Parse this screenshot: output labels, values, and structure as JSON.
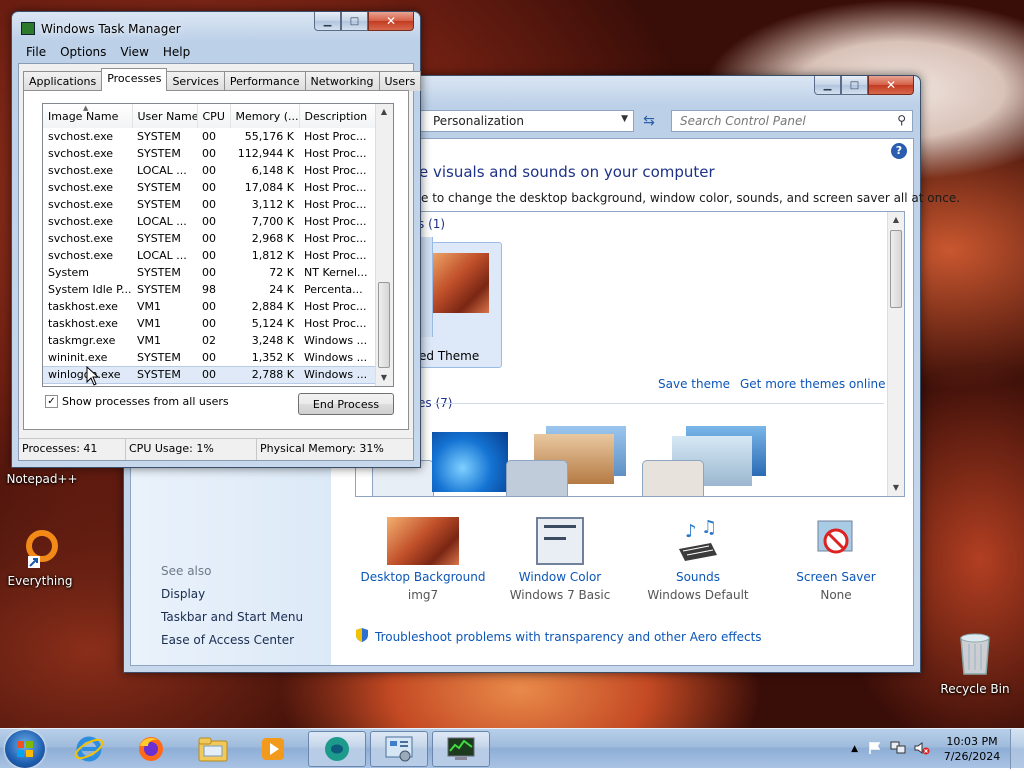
{
  "colors": {
    "accent": "#0c56b8",
    "heading": "#1e3287"
  },
  "desktop": {
    "icons": [
      {
        "label": "Notepad++",
        "icon": "notepadpp-icon"
      },
      {
        "label": "Everything",
        "icon": "everything-icon"
      },
      {
        "label": "Recycle Bin",
        "icon": "recycle-bin-icon"
      }
    ]
  },
  "control_panel": {
    "address": "Personalization",
    "search_placeholder": "Search Control Panel",
    "heading": "e visuals and sounds on your computer",
    "subheading": "e to change the desktop background, window color, sounds, and screen saver all at once.",
    "my_themes_label": "s (1)",
    "unsaved_theme_label": "ed Theme",
    "save_theme": "Save theme",
    "get_more_themes": "Get more themes online",
    "aero_themes_label": "es (7)",
    "bottom": [
      {
        "name": "Desktop Background",
        "value": "img7",
        "icon": "desktop-background-icon"
      },
      {
        "name": "Window Color",
        "value": "Windows 7 Basic",
        "icon": "window-color-icon"
      },
      {
        "name": "Sounds",
        "value": "Windows Default",
        "icon": "sounds-icon"
      },
      {
        "name": "Screen Saver",
        "value": "None",
        "icon": "screen-saver-icon"
      }
    ],
    "troubleshoot": "Troubleshoot problems with transparency and other Aero effects",
    "see_also": {
      "title": "See also",
      "links": [
        "Display",
        "Taskbar and Start Menu",
        "Ease of Access Center"
      ]
    }
  },
  "task_manager": {
    "title": "Windows Task Manager",
    "menu": [
      "File",
      "Options",
      "View",
      "Help"
    ],
    "tabs": [
      "Applications",
      "Processes",
      "Services",
      "Performance",
      "Networking",
      "Users"
    ],
    "active_tab": "Processes",
    "columns": [
      "Image Name",
      "User Name",
      "CPU",
      "Memory (...",
      "Description"
    ],
    "rows": [
      [
        "svchost.exe",
        "SYSTEM",
        "00",
        "55,176 K",
        "Host Proc..."
      ],
      [
        "svchost.exe",
        "SYSTEM",
        "00",
        "112,944 K",
        "Host Proc..."
      ],
      [
        "svchost.exe",
        "LOCAL ...",
        "00",
        "6,148 K",
        "Host Proc..."
      ],
      [
        "svchost.exe",
        "SYSTEM",
        "00",
        "17,084 K",
        "Host Proc..."
      ],
      [
        "svchost.exe",
        "SYSTEM",
        "00",
        "3,112 K",
        "Host Proc..."
      ],
      [
        "svchost.exe",
        "LOCAL ...",
        "00",
        "7,700 K",
        "Host Proc..."
      ],
      [
        "svchost.exe",
        "SYSTEM",
        "00",
        "2,968 K",
        "Host Proc..."
      ],
      [
        "svchost.exe",
        "LOCAL ...",
        "00",
        "1,812 K",
        "Host Proc..."
      ],
      [
        "System",
        "SYSTEM",
        "00",
        "72 K",
        "NT Kernel..."
      ],
      [
        "System Idle P...",
        "SYSTEM",
        "98",
        "24 K",
        "Percenta..."
      ],
      [
        "taskhost.exe",
        "VM1",
        "00",
        "2,884 K",
        "Host Proc..."
      ],
      [
        "taskhost.exe",
        "VM1",
        "00",
        "5,124 K",
        "Host Proc..."
      ],
      [
        "taskmgr.exe",
        "VM1",
        "02",
        "3,248 K",
        "Windows ..."
      ],
      [
        "wininit.exe",
        "SYSTEM",
        "00",
        "1,352 K",
        "Windows ..."
      ],
      [
        "winlogon.exe",
        "SYSTEM",
        "00",
        "2,788 K",
        "Windows ..."
      ]
    ],
    "selected_row": 14,
    "show_all_label": "Show processes from all users",
    "show_all_checked": true,
    "end_process": "End Process",
    "status": {
      "processes": "Processes: 41",
      "cpu": "CPU Usage: 1%",
      "memory": "Physical Memory: 31%"
    }
  },
  "taskbar": {
    "time": "10:03 PM",
    "date": "7/26/2024",
    "pinned": [
      "start-orb-icon",
      "internet-explorer-icon",
      "firefox-icon",
      "explorer-icon",
      "media-player-icon",
      "app-icon",
      "control-panel-icon",
      "task-manager-icon"
    ]
  }
}
